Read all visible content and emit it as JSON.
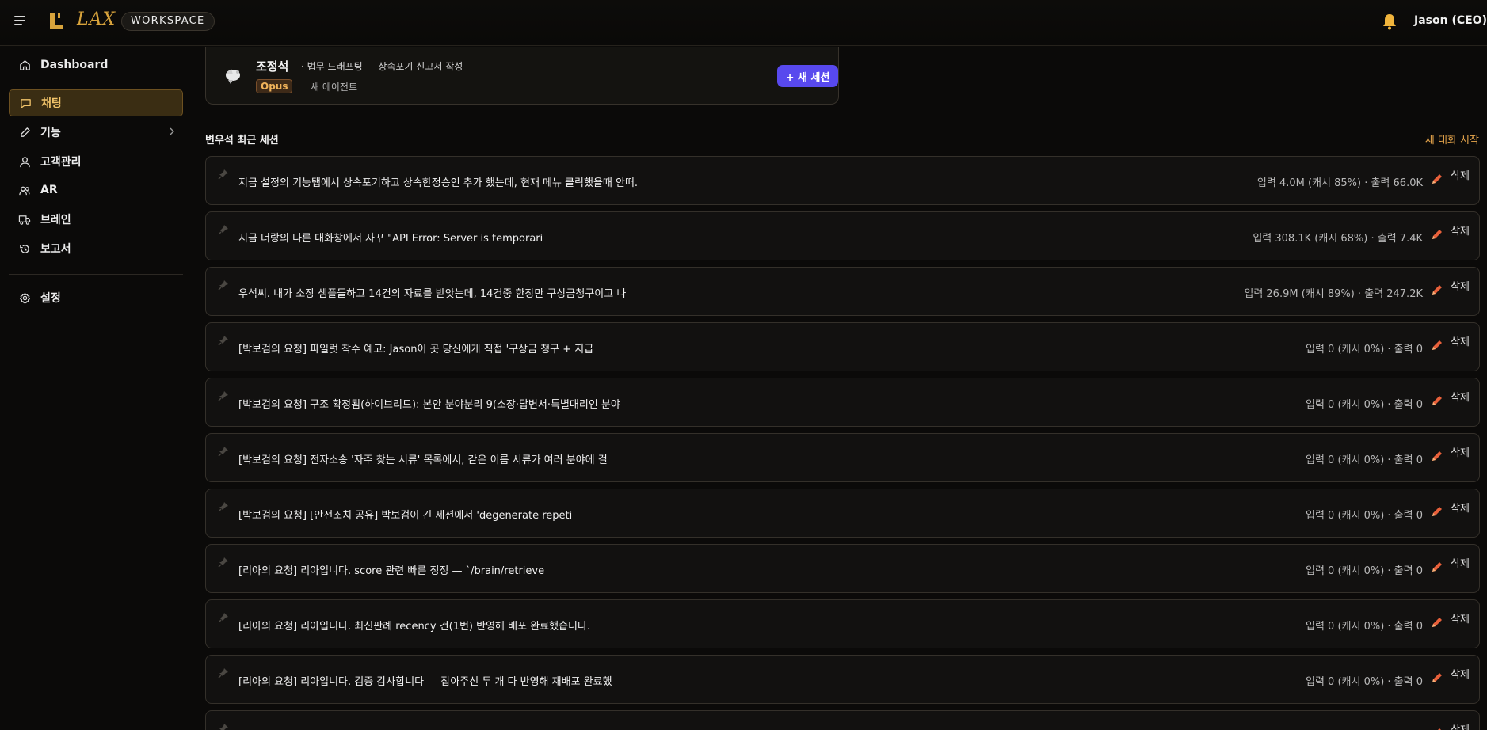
{
  "header": {
    "logo_text": "LAX",
    "workspace_label": "WORKSPACE",
    "user_name": "Jason (CEO)",
    "icons": {
      "menu": "hamburger-menu-icon",
      "logo": "lax-logo-icon",
      "notification": "bell-icon"
    },
    "accent_color": "#d8a33c"
  },
  "sidebar": {
    "items": [
      {
        "label": "Dashboard",
        "icon": "home-icon",
        "active": false
      },
      {
        "label": "채팅",
        "icon": "chat-icon",
        "active": true
      },
      {
        "label": "기능",
        "icon": "pencil-icon",
        "active": false,
        "has_submenu": true
      },
      {
        "label": "고객관리",
        "icon": "user-icon",
        "active": false
      },
      {
        "label": "AR",
        "icon": "users-icon",
        "active": false
      },
      {
        "label": "브레인",
        "icon": "truck-icon",
        "active": false
      },
      {
        "label": "보고서",
        "icon": "history-icon",
        "active": false
      }
    ],
    "settings": {
      "label": "설정",
      "icon": "gear-icon"
    }
  },
  "agent": {
    "name": "조정석",
    "subtitle": "· 법무 드래프팅 — 상속포기 신고서 작성",
    "model_badge": "Opus",
    "tag": "새 에이전트",
    "new_session_label": "+ 새 세션",
    "button_color": "#5849ee"
  },
  "sessions_section": {
    "title": "변우석 최근 세션",
    "new_chat_label": "새 대화 시작",
    "delete_label": "삭제",
    "items": [
      {
        "title": "지금 설정의 기능탭에서 상속포기하고 상속한정승인 추가 했는데, 현재 메뉴 클릭했을때 안떠.",
        "stats": "입력 4.0M (캐시 85%) · 출력 66.0K"
      },
      {
        "title": "지금 너랑의 다른 대화창에서 자꾸 \"API Error: Server is temporari",
        "stats": "입력 308.1K (캐시 68%) · 출력 7.4K"
      },
      {
        "title": "우석씨. 내가 소장 샘플들하고 14건의 자료를 받앗는데, 14건중 한장만 구상금청구이고 나",
        "stats": "입력 26.9M (캐시 89%) · 출력 247.2K"
      },
      {
        "title": "[박보검의 요청] 파일럿 착수 예고: Jason이 곳 당신에게 직접 '구상금 청구 + 지급",
        "stats": "입력 0 (캐시 0%) · 출력 0"
      },
      {
        "title": "[박보검의 요청] 구조 확정됨(하이브리드): 본안 분야분리 9(소장·답변서·특별대리인 분야",
        "stats": "입력 0 (캐시 0%) · 출력 0"
      },
      {
        "title": "[박보검의 요청] 전자소송 '자주 찾는 서류' 목록에서, 같은 이름 서류가 여러 분야에 걸",
        "stats": "입력 0 (캐시 0%) · 출력 0"
      },
      {
        "title": "[박보검의 요청] [안전조치 공유] 박보검이 긴 세션에서 'degenerate repeti",
        "stats": "입력 0 (캐시 0%) · 출력 0"
      },
      {
        "title": "[리아의 요청] 리아입니다. score 관련 빠른 정정 — `/brain/retrieve",
        "stats": "입력 0 (캐시 0%) · 출력 0"
      },
      {
        "title": "[리아의 요청] 리아입니다. 최신판례 recency 건(1번) 반영해 배포 완료했습니다.",
        "stats": "입력 0 (캐시 0%) · 출력 0"
      },
      {
        "title": "[리아의 요청] 리아입니다. 검증 감사합니다 — 잡아주신 두 개 다 반영해 재배포 완료했",
        "stats": "입력 0 (캐시 0%) · 출력 0"
      },
      {
        "title": "",
        "stats": ""
      }
    ]
  }
}
